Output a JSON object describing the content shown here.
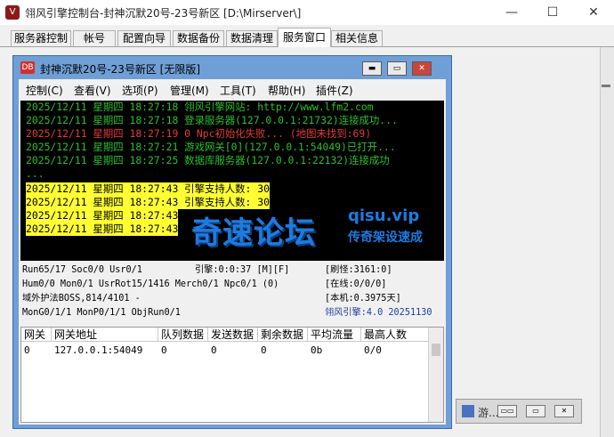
{
  "window": {
    "title": "翎风引擎控制台-封神沉默20号-23号新区 [D:\\Mirserver\\]",
    "minimize": "—",
    "maximize": "☐",
    "close": "✕"
  },
  "tabs": [
    "服务器控制",
    "帐号",
    "配置向导",
    "数据备份",
    "数据清理",
    "服务窗口",
    "相关信息"
  ],
  "inner_window": {
    "icon_text": "DB",
    "title": "封神沉默20号-23号新区 [无限版]",
    "btn_min": "▬",
    "btn_max": "▭",
    "btn_close": "✕"
  },
  "menu": [
    "控制(C)",
    "查看(V)",
    "选项(P)",
    "管理(M)",
    "工具(T)",
    "帮助(H)",
    "插件(Z)"
  ],
  "log": [
    {
      "text": "2025/12/11 星期四 18:27:18 翎风引擎网站: http://www.lfm2.com",
      "style": "green"
    },
    {
      "text": "2025/12/11 星期四 18:27:18 登录服务器(127.0.0.1:21732)连接成功...",
      "style": "green"
    },
    {
      "text": "2025/12/11 星期四 18:27:19 0 Npc初始化失败... (地图未找到:69)",
      "style": "red"
    },
    {
      "text": "2025/12/11 星期四 18:27:21 游戏网关[0](127.0.0.1:54049)已打开...",
      "style": "green"
    },
    {
      "text": "2025/12/11 星期四 18:27:25 数据库服务器(127.0.0.1:22132)连接成功",
      "style": "green"
    },
    {
      "text": "...",
      "style": "green"
    },
    {
      "text": "2025/12/11 星期四 18:27:43 引擎支持人数: 30",
      "style": "hl"
    },
    {
      "text": "2025/12/11 星期四 18:27:43 引擎支持人数: 30",
      "style": "hl"
    },
    {
      "text": "2025/12/11 星期四 18:27:43",
      "style": "hl"
    },
    {
      "text": "2025/12/11 星期四 18:27:43",
      "style": "hl"
    }
  ],
  "watermark": {
    "cn": "奇速论坛",
    "en": "qisu.vip",
    "sub": "传奇架设速成"
  },
  "stats": {
    "run": "Run65/17 Soc0/0 Usr0/1",
    "engine_time": "引擎:0:0:37 [M][F]",
    "refresh": "[刷怪:3161:0]",
    "hum": "Hum0/0 Mon0/1 UsrRot15/1416 Merch0/1 Npc0/1 (0)",
    "online": "[在线:0/0/0]",
    "boss": "域外护法BOSS,814/4101 -",
    "machine": "[本机:0.3975天]",
    "mongo": "MonG0/1/1 MonP0/1/1 ObjRun0/1",
    "version": "翎风引擎:4.0 20251130"
  },
  "grid": {
    "columns": [
      "网关",
      "网关地址",
      "队列数据",
      "发送数据",
      "剩余数据",
      "平均流量",
      "最高人数"
    ],
    "rows": [
      [
        "0",
        "127.0.0.1:54049",
        "0",
        "0",
        "0",
        "0b",
        "0/0"
      ]
    ]
  },
  "mini_window": {
    "title": "游..."
  },
  "colors": {
    "log_green": "#2dbf2d",
    "log_red": "#e23a3a",
    "highlight": "#ffff33",
    "title_bar_blue": "#6f9fd6",
    "watermark_blue": "#1e7be0"
  }
}
